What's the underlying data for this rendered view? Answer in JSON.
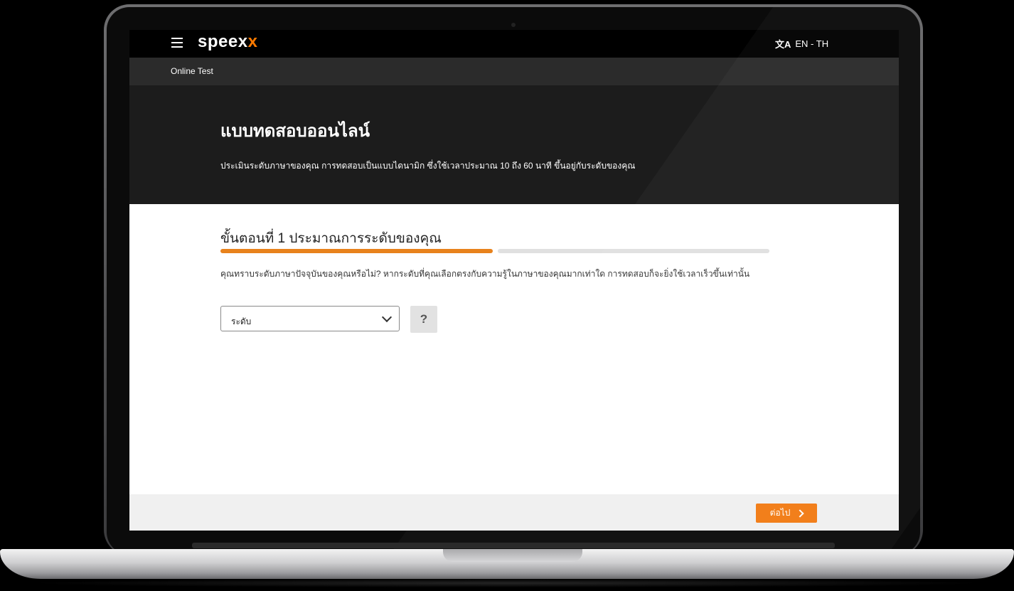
{
  "header": {
    "logo_main": "speex",
    "logo_accent": "x",
    "language_icon": "translate-icon",
    "language_label": "EN - TH"
  },
  "subnav": {
    "breadcrumb": "Online Test"
  },
  "hero": {
    "title": "แบบทดสอบออนไลน์",
    "description": "ประเมินระดับภาษาของคุณ การทดสอบเป็นแบบไดนามิก ซึ่งใช้เวลาประมาณ 10 ถึง 60 นาที ขึ้นอยู่กับระดับของคุณ"
  },
  "step": {
    "title": "ขั้นตอนที่ 1 ประมาณการระดับของคุณ",
    "progress_current": 1,
    "progress_total": 2,
    "question": "คุณทราบระดับภาษาปัจจุบันของคุณหรือไม่? หากระดับที่คุณเลือกตรงกับความรู้ในภาษาของคุณมากเท่าใด การทดสอบก็จะยิ่งใช้เวลาเร็วขึ้นเท่านั้น",
    "level_select_value": "ระดับ",
    "help_label": "?"
  },
  "footer": {
    "next_label": "ต่อไป"
  },
  "colors": {
    "accent": "#f27b14",
    "progress": "#e8821c",
    "hero_bg": "#1c1c1c"
  }
}
